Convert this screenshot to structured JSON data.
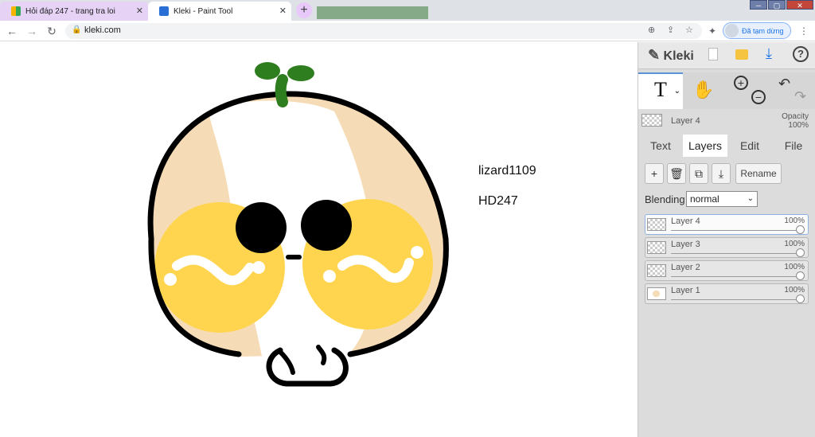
{
  "browser": {
    "tabs": [
      {
        "title": "Hỏi đáp 247 - trang tra loi",
        "active": false
      },
      {
        "title": "Kleki - Paint Tool",
        "active": true
      }
    ],
    "new_tab": "+",
    "address": "kleki.com",
    "profile_label": "Đã tạm dừng",
    "window_controls": [
      "─",
      "▢",
      "✕"
    ]
  },
  "canvas": {
    "texts": [
      "lizard1109",
      "HD247"
    ]
  },
  "app": {
    "name": "Kleki",
    "current_tool": "T",
    "layer_bar": {
      "layer_name": "Layer 4",
      "opacity_label": "Opacity",
      "opacity_value": "100%"
    },
    "panel_tabs": [
      "Text",
      "Layers",
      "Edit",
      "File"
    ],
    "active_tab": "Layers",
    "buttons": {
      "add": "+",
      "delete": "🗑",
      "duplicate": "⧉",
      "merge": "⤓",
      "rename": "Rename"
    },
    "blending": {
      "label": "Blending",
      "value": "normal"
    },
    "layers": [
      {
        "name": "Layer 4",
        "opacity": "100%",
        "level": 1.0,
        "active": true
      },
      {
        "name": "Layer 3",
        "opacity": "100%",
        "level": 1.0,
        "active": false
      },
      {
        "name": "Layer 2",
        "opacity": "100%",
        "level": 1.0,
        "active": false
      },
      {
        "name": "Layer 1",
        "opacity": "100%",
        "level": 1.0,
        "active": false
      }
    ]
  },
  "colors": {
    "sprout": "#2e7d1f",
    "face_fill": "#f6dcb6",
    "cheek": "#ffd54f",
    "accent": "#2a6fd6"
  }
}
